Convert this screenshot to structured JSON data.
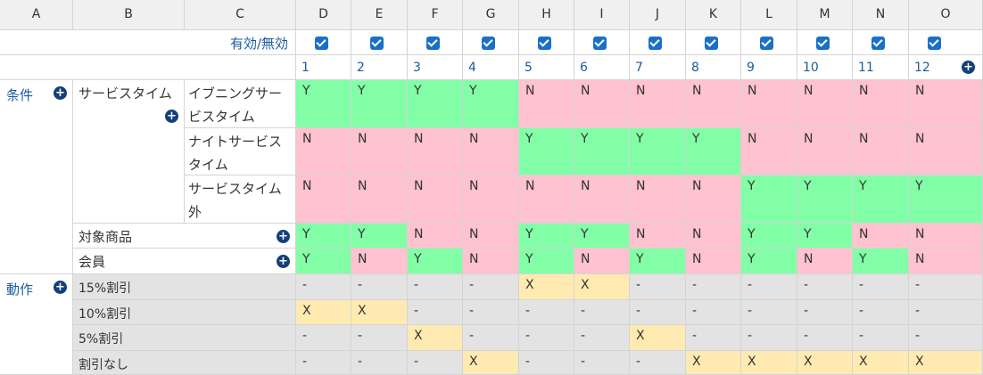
{
  "columns": [
    "A",
    "B",
    "C",
    "D",
    "E",
    "F",
    "G",
    "H",
    "I",
    "J",
    "K",
    "L",
    "M",
    "N",
    "O"
  ],
  "enable_label": "有効/無効",
  "enabled": [
    true,
    true,
    true,
    true,
    true,
    true,
    true,
    true,
    true,
    true,
    true,
    true
  ],
  "rule_numbers": [
    "1",
    "2",
    "3",
    "4",
    "5",
    "6",
    "7",
    "8",
    "9",
    "10",
    "11",
    "12"
  ],
  "conditions_label": "条件",
  "actions_label": "動作",
  "service_time_label": "サービスタイム",
  "conditions": [
    {
      "label": "イブニングサービスタイム",
      "values": [
        "Y",
        "Y",
        "Y",
        "Y",
        "N",
        "N",
        "N",
        "N",
        "N",
        "N",
        "N",
        "N"
      ]
    },
    {
      "label": "ナイトサービスタイム",
      "values": [
        "N",
        "N",
        "N",
        "N",
        "Y",
        "Y",
        "Y",
        "Y",
        "N",
        "N",
        "N",
        "N"
      ]
    },
    {
      "label": "サービスタイム外",
      "values": [
        "N",
        "N",
        "N",
        "N",
        "N",
        "N",
        "N",
        "N",
        "Y",
        "Y",
        "Y",
        "Y"
      ]
    },
    {
      "label": "対象商品",
      "values": [
        "Y",
        "Y",
        "N",
        "N",
        "Y",
        "Y",
        "N",
        "N",
        "Y",
        "Y",
        "N",
        "N"
      ]
    },
    {
      "label": "会員",
      "values": [
        "Y",
        "N",
        "Y",
        "N",
        "Y",
        "N",
        "Y",
        "N",
        "Y",
        "N",
        "Y",
        "N"
      ]
    }
  ],
  "actions": [
    {
      "label": "15%割引",
      "values": [
        "-",
        "-",
        "-",
        "-",
        "X",
        "X",
        "-",
        "-",
        "-",
        "-",
        "-",
        "-"
      ]
    },
    {
      "label": "10%割引",
      "values": [
        "X",
        "X",
        "-",
        "-",
        "-",
        "-",
        "-",
        "-",
        "-",
        "-",
        "-",
        "-"
      ]
    },
    {
      "label": "5%割引",
      "values": [
        "-",
        "-",
        "X",
        "-",
        "-",
        "-",
        "X",
        "-",
        "-",
        "-",
        "-",
        "-"
      ]
    },
    {
      "label": "割引なし",
      "values": [
        "-",
        "-",
        "-",
        "X",
        "-",
        "-",
        "-",
        "X",
        "X",
        "X",
        "X",
        "X"
      ]
    }
  ],
  "colors": {
    "yes": "#82ffa6",
    "no": "#ffc2cf",
    "action": "#ffeab1",
    "empty": "#e3e3e3",
    "link": "#1a5b9e"
  },
  "icons": {
    "add": "plus-circle-icon",
    "check": "checkbox-checked-icon"
  }
}
